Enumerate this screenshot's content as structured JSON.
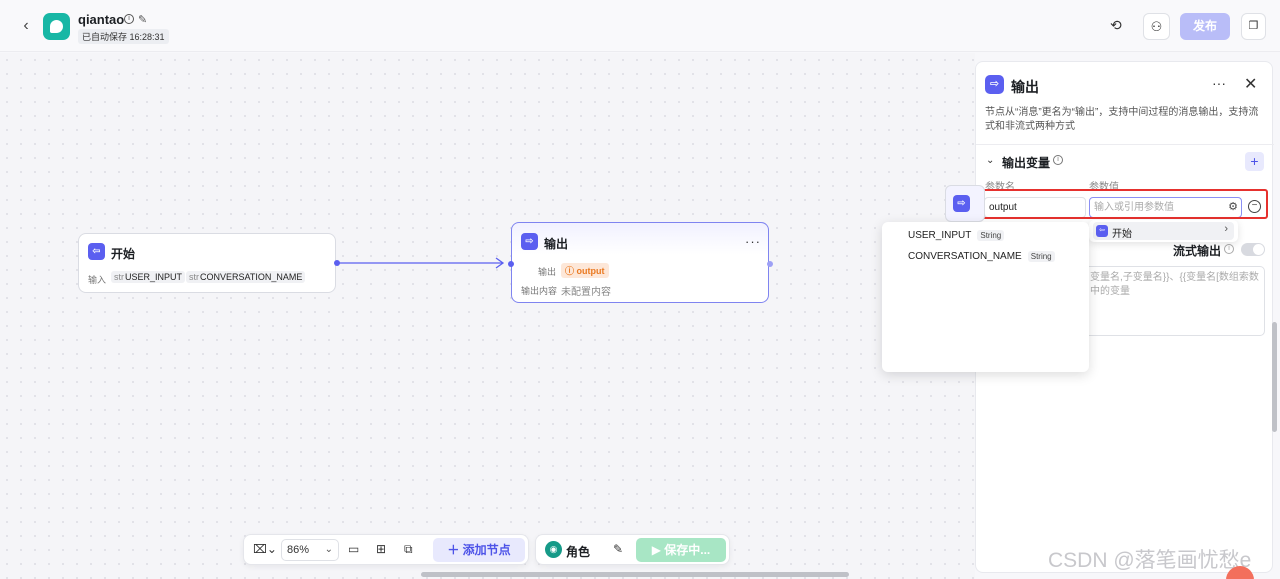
{
  "header": {
    "back_icon": "chevron-left-icon",
    "app_name": "qiantao",
    "autosave": "已自动保存 16:28:31",
    "publish_label": "发布"
  },
  "nodes": {
    "start": {
      "title": "开始",
      "input_label": "输入",
      "inputs": [
        {
          "type": "str",
          "name": "USER_INPUT"
        },
        {
          "type": "str",
          "name": "CONVERSATION_NAME"
        }
      ]
    },
    "output": {
      "title": "输出",
      "output_label": "输出",
      "output_var": "output",
      "content_label": "输出内容",
      "content_value": "未配置内容"
    }
  },
  "toolbar": {
    "zoom": "86%",
    "add_node_label": "添加节点",
    "role_label": "角色",
    "save_label": "保存中..."
  },
  "panel": {
    "title": "输出",
    "description": "节点从“消息”更名为“输出”，支持中间过程的消息输出，支持流式和非流式两种方式",
    "section_title": "输出变量",
    "param_name_header": "参数名",
    "param_value_header": "参数值",
    "param_name": "output",
    "param_value_placeholder": "输入或引用参数值",
    "stream_label": "流式输出",
    "content_hint": "变量名,子变量名}}、{{变量名[数组索数中的变量"
  },
  "dropdown": {
    "group": "开始",
    "items": [
      {
        "name": "USER_INPUT",
        "type": "String"
      },
      {
        "name": "CONVERSATION_NAME",
        "type": "String"
      }
    ]
  },
  "watermark": "CSDN @落笔画忧愁e",
  "colors": {
    "accent": "#5b5ff0",
    "publish_disabled": "#b9bdf8",
    "output_tag": "#ea7a22",
    "highlight": "#e6312e",
    "brand": "#18b7a5"
  }
}
